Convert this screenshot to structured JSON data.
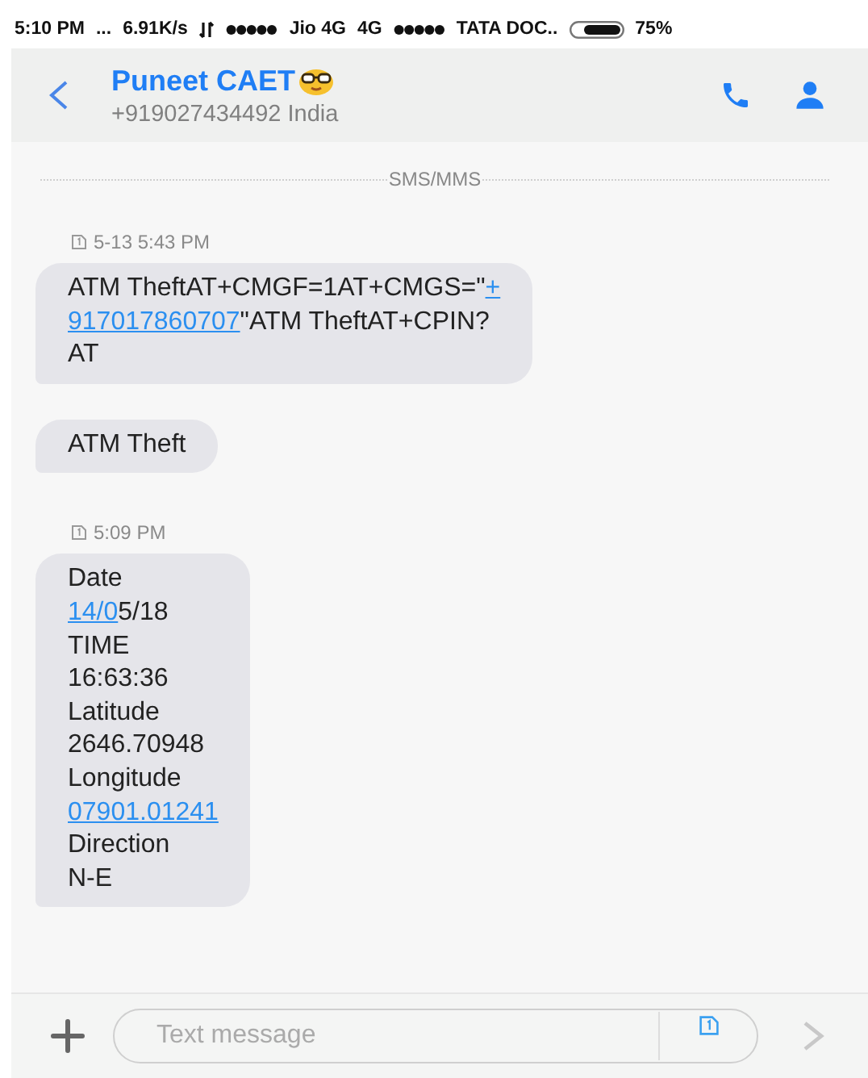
{
  "status_bar": {
    "time": "5:10 PM",
    "more": "...",
    "speed": "6.91K/s",
    "carrier_1": "Jio 4G",
    "network_1": "4G",
    "carrier_2": "TATA DOC..",
    "battery": "75%"
  },
  "header": {
    "name": "Puneet CAET",
    "number": "+919027434492 India"
  },
  "divider_label": "SMS/MMS",
  "groups": [
    {
      "time": "5-13 5:43 PM",
      "bubbles": [
        {
          "lines": [
            [
              {
                "kind": "text",
                "text": "ATM TheftAT+CMGF=1AT+CMGS=\""
              },
              {
                "kind": "link",
                "text": "+"
              }
            ],
            [
              {
                "kind": "link",
                "text": "917017860707"
              },
              {
                "kind": "text",
                "text": "\"ATM TheftAT+CPIN?"
              }
            ],
            [
              {
                "kind": "text",
                "text": "AT"
              }
            ]
          ]
        },
        {
          "lines": [
            [
              {
                "kind": "text",
                "text": "ATM Theft"
              }
            ]
          ]
        }
      ]
    },
    {
      "time": "5:09 PM",
      "bubbles": [
        {
          "lines": [
            [
              {
                "kind": "text",
                "text": "Date"
              }
            ],
            [
              {
                "kind": "link",
                "text": "14/0"
              },
              {
                "kind": "text",
                "text": "5/18"
              }
            ],
            [
              {
                "kind": "text",
                "text": "TIME"
              }
            ],
            [
              {
                "kind": "text",
                "text": "16:63:36"
              }
            ],
            [
              {
                "kind": "text",
                "text": "Latitude"
              }
            ],
            [
              {
                "kind": "text",
                "text": "2646.70948"
              }
            ],
            [
              {
                "kind": "text",
                "text": "Longitude"
              }
            ],
            [
              {
                "kind": "link",
                "text": "07901.01241"
              }
            ],
            [
              {
                "kind": "text",
                "text": "Direction"
              }
            ],
            [
              {
                "kind": "text",
                "text": "N-E"
              }
            ]
          ]
        }
      ]
    }
  ],
  "composer": {
    "placeholder": "Text message"
  }
}
